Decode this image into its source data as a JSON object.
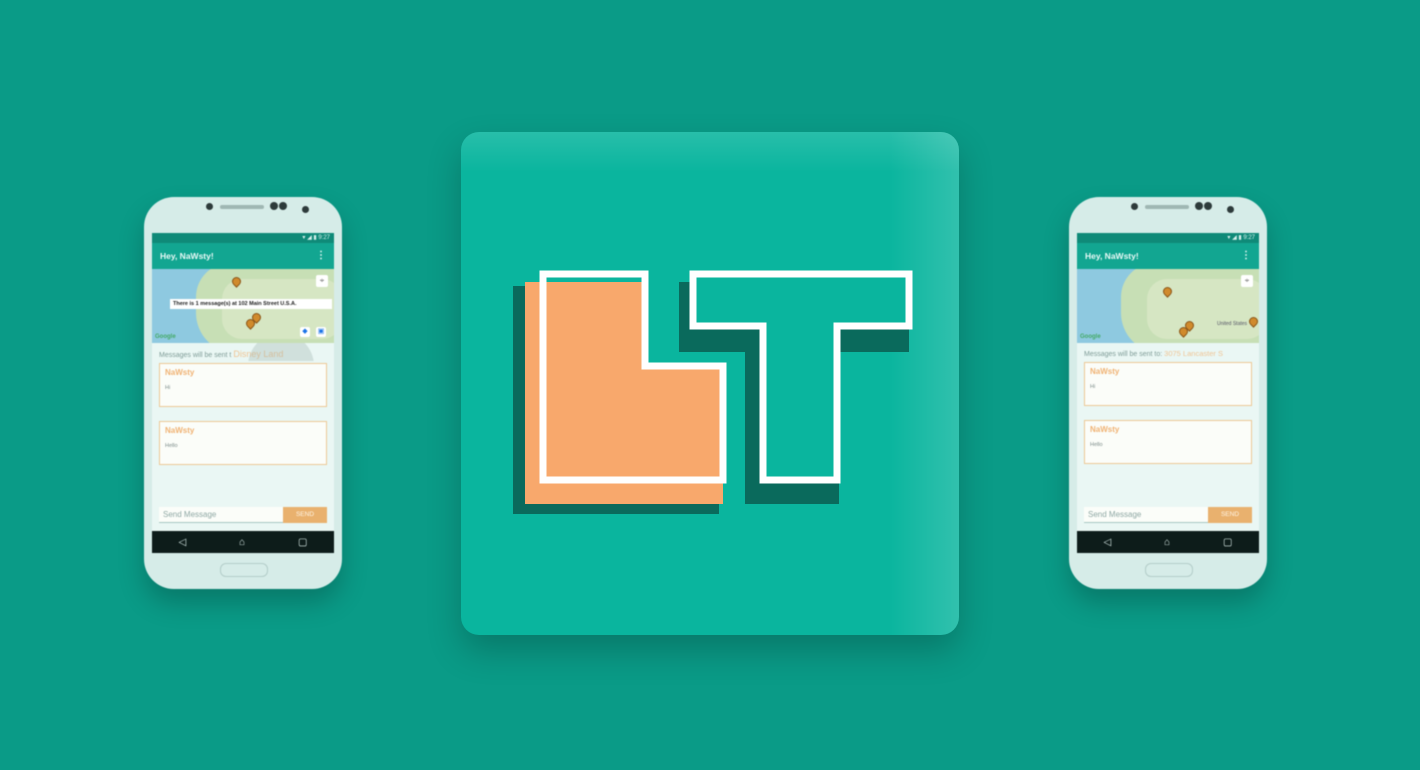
{
  "colors": {
    "background": "#0a9b87",
    "logo_tile": "#0ab59e",
    "logo_orange": "#f8a86c",
    "logo_white": "#ffffff",
    "app_bar": "#12a691",
    "accent_orange": "#e9b16e"
  },
  "logo": {
    "letters": "LT"
  },
  "phone_left": {
    "app_title": "Hey, NaWsty!",
    "map_banner": "There is 1 message(s) at 102 Main Street U.S.A.",
    "google_mark": "Google",
    "recipient_prefix": "Messages will be sent t",
    "recipient_place": "Disney Land",
    "messages": [
      {
        "author": "NaWsty",
        "text": "Hi"
      },
      {
        "author": "NaWsty",
        "text": "Hello"
      }
    ],
    "compose_placeholder": "Send Message",
    "send_label": "SEND"
  },
  "phone_right": {
    "app_title": "Hey, NaWsty!",
    "google_mark": "Google",
    "map_label": "United States",
    "recipient_prefix": "Messages will be sent to:",
    "recipient_place": "3075 Lancaster S",
    "messages": [
      {
        "author": "NaWsty",
        "text": "Hi"
      },
      {
        "author": "NaWsty",
        "text": "Hello"
      }
    ],
    "compose_placeholder": "Send Message",
    "send_label": "SEND"
  }
}
